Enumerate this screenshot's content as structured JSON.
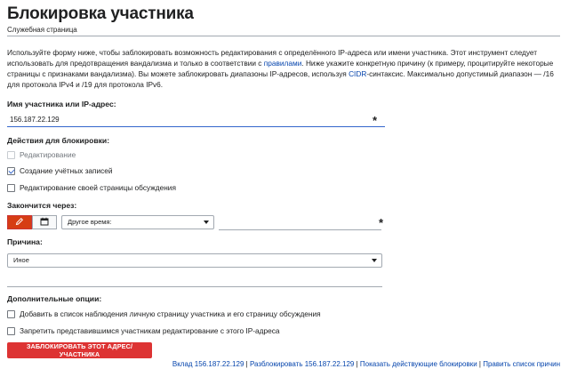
{
  "header": {
    "title": "Блокировка участника",
    "subtitle": "Служебная страница"
  },
  "intro": {
    "part1": "Используйте форму ниже, чтобы заблокировать возможность редактирования с определённого IP-адреса или имени участника. Этот инструмент следует использовать для предотвращения вандализма и только в соответствии с ",
    "link_rules": "правилами",
    "part2": ". Ниже укажите конкретную причину (к примеру, процитируйте некоторые страницы с признаками вандализма). Вы можете заблокировать диапазоны IP-адресов, используя ",
    "link_cidr": "CIDR",
    "part3": "-синтаксис. Максимально допустимый диапазон — /16 для протокола IPv4 и /19 для протокола IPv6."
  },
  "target": {
    "label": "Имя участника или IP-адрес:",
    "value": "156.187.22.129",
    "required_mark": "*"
  },
  "actions": {
    "label": "Действия для блокировки:",
    "items": [
      {
        "label": "Редактирование",
        "checked": false,
        "disabled": true
      },
      {
        "label": "Создание учётных записей",
        "checked": true,
        "disabled": false
      },
      {
        "label": "Редактирование своей страницы обсуждения",
        "checked": false,
        "disabled": false
      }
    ]
  },
  "expiry": {
    "label": "Закончится через:",
    "select_value": "Другое время:",
    "required_mark": "*"
  },
  "reason": {
    "label": "Причина:",
    "select_value": "Иное"
  },
  "options": {
    "label": "Дополнительные опции:",
    "items": [
      {
        "label": "Добавить в список наблюдения личную страницу участника и его страницу обсуждения",
        "checked": false
      },
      {
        "label": "Запретить представившимся участникам редактирование с этого IP-адреса",
        "checked": false
      }
    ]
  },
  "submit": {
    "label": "ЗАБЛОКИРОВАТЬ ЭТОТ АДРЕС/УЧАСТНИКА"
  },
  "footer": {
    "contribs": "Вклад 156.187.22.129",
    "unblock": "Разблокировать 156.187.22.129",
    "show_blocks": "Показать действующие блокировки",
    "edit_reasons": "Править список причин",
    "separator": " | "
  },
  "colors": {
    "accent": "#3366cc",
    "danger": "#dd3333",
    "active_toggle": "#d63d14",
    "link": "#0645ad"
  },
  "icons": {
    "toggle_custom": "pencil-icon",
    "toggle_calendar": "calendar-icon"
  }
}
